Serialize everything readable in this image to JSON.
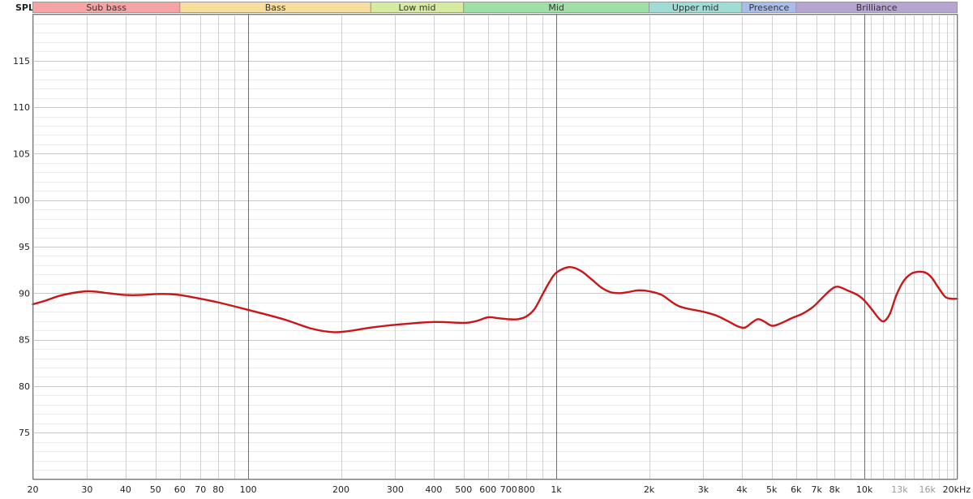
{
  "chart_data": {
    "type": "line",
    "ylabel": "SPL",
    "x_unit": "kHz",
    "x_scale": "log",
    "xlim": [
      20,
      20000
    ],
    "ylim": [
      70,
      120
    ],
    "y_ticks": [
      75,
      80,
      85,
      90,
      95,
      100,
      105,
      110,
      115
    ],
    "x_ticks": [
      {
        "value": 20,
        "label": "20"
      },
      {
        "value": 30,
        "label": "30"
      },
      {
        "value": 40,
        "label": "40"
      },
      {
        "value": 50,
        "label": "50"
      },
      {
        "value": 60,
        "label": "60"
      },
      {
        "value": 70,
        "label": "70"
      },
      {
        "value": 80,
        "label": "80"
      },
      {
        "value": 100,
        "label": "100"
      },
      {
        "value": 200,
        "label": "200"
      },
      {
        "value": 300,
        "label": "300"
      },
      {
        "value": 400,
        "label": "400"
      },
      {
        "value": 500,
        "label": "500"
      },
      {
        "value": 600,
        "label": "600"
      },
      {
        "value": 700,
        "label": "700"
      },
      {
        "value": 800,
        "label": "800"
      },
      {
        "value": 1000,
        "label": "1k"
      },
      {
        "value": 2000,
        "label": "2k"
      },
      {
        "value": 3000,
        "label": "3k"
      },
      {
        "value": 4000,
        "label": "4k"
      },
      {
        "value": 5000,
        "label": "5k"
      },
      {
        "value": 6000,
        "label": "6k"
      },
      {
        "value": 7000,
        "label": "7k"
      },
      {
        "value": 8000,
        "label": "8k"
      },
      {
        "value": 10000,
        "label": "10k"
      },
      {
        "value": 13000,
        "label": "13k",
        "minor": true
      },
      {
        "value": 16000,
        "label": "16k",
        "minor": true
      },
      {
        "value": 20000,
        "label": "20kHz"
      }
    ],
    "bands": [
      {
        "name": "Sub bass",
        "from": 20,
        "to": 60,
        "color": "#f7a3a3"
      },
      {
        "name": "Bass",
        "from": 60,
        "to": 250,
        "color": "#f7de9b"
      },
      {
        "name": "Low mid",
        "from": 250,
        "to": 500,
        "color": "#d6eaa0"
      },
      {
        "name": "Mid",
        "from": 500,
        "to": 2000,
        "color": "#9ee0a6"
      },
      {
        "name": "Upper mid",
        "from": 2000,
        "to": 4000,
        "color": "#9edcd4"
      },
      {
        "name": "Presence",
        "from": 4000,
        "to": 6000,
        "color": "#a9bde8"
      },
      {
        "name": "Brilliance",
        "from": 6000,
        "to": 20000,
        "color": "#b6a5d1"
      }
    ],
    "grid": true,
    "series": [
      {
        "color": "#c8171b",
        "points": [
          [
            20,
            88.8
          ],
          [
            22,
            89.2
          ],
          [
            25,
            89.8
          ],
          [
            30,
            90.2
          ],
          [
            35,
            90.0
          ],
          [
            40,
            89.8
          ],
          [
            45,
            89.8
          ],
          [
            50,
            89.9
          ],
          [
            55,
            89.9
          ],
          [
            60,
            89.8
          ],
          [
            70,
            89.4
          ],
          [
            80,
            89.0
          ],
          [
            100,
            88.2
          ],
          [
            130,
            87.2
          ],
          [
            160,
            86.2
          ],
          [
            190,
            85.8
          ],
          [
            220,
            86.0
          ],
          [
            250,
            86.3
          ],
          [
            300,
            86.6
          ],
          [
            400,
            86.9
          ],
          [
            500,
            86.8
          ],
          [
            550,
            87.0
          ],
          [
            600,
            87.4
          ],
          [
            650,
            87.3
          ],
          [
            700,
            87.2
          ],
          [
            750,
            87.2
          ],
          [
            800,
            87.5
          ],
          [
            850,
            88.3
          ],
          [
            900,
            89.8
          ],
          [
            950,
            91.2
          ],
          [
            1000,
            92.2
          ],
          [
            1100,
            92.8
          ],
          [
            1200,
            92.4
          ],
          [
            1300,
            91.5
          ],
          [
            1400,
            90.6
          ],
          [
            1500,
            90.1
          ],
          [
            1600,
            90.0
          ],
          [
            1700,
            90.1
          ],
          [
            1850,
            90.3
          ],
          [
            2000,
            90.2
          ],
          [
            2200,
            89.8
          ],
          [
            2500,
            88.6
          ],
          [
            3000,
            88.0
          ],
          [
            3300,
            87.6
          ],
          [
            3600,
            87.0
          ],
          [
            3900,
            86.4
          ],
          [
            4100,
            86.3
          ],
          [
            4300,
            86.8
          ],
          [
            4500,
            87.2
          ],
          [
            4700,
            87.0
          ],
          [
            5000,
            86.5
          ],
          [
            5300,
            86.7
          ],
          [
            5800,
            87.3
          ],
          [
            6300,
            87.8
          ],
          [
            6800,
            88.5
          ],
          [
            7300,
            89.5
          ],
          [
            7800,
            90.4
          ],
          [
            8200,
            90.7
          ],
          [
            8800,
            90.3
          ],
          [
            9500,
            89.8
          ],
          [
            10000,
            89.2
          ],
          [
            10600,
            88.2
          ],
          [
            11200,
            87.2
          ],
          [
            11600,
            87.0
          ],
          [
            12100,
            87.8
          ],
          [
            12700,
            89.8
          ],
          [
            13400,
            91.3
          ],
          [
            14200,
            92.1
          ],
          [
            15000,
            92.3
          ],
          [
            15800,
            92.2
          ],
          [
            16500,
            91.7
          ],
          [
            17300,
            90.7
          ],
          [
            18300,
            89.6
          ],
          [
            19200,
            89.4
          ],
          [
            20000,
            89.4
          ]
        ]
      }
    ]
  }
}
